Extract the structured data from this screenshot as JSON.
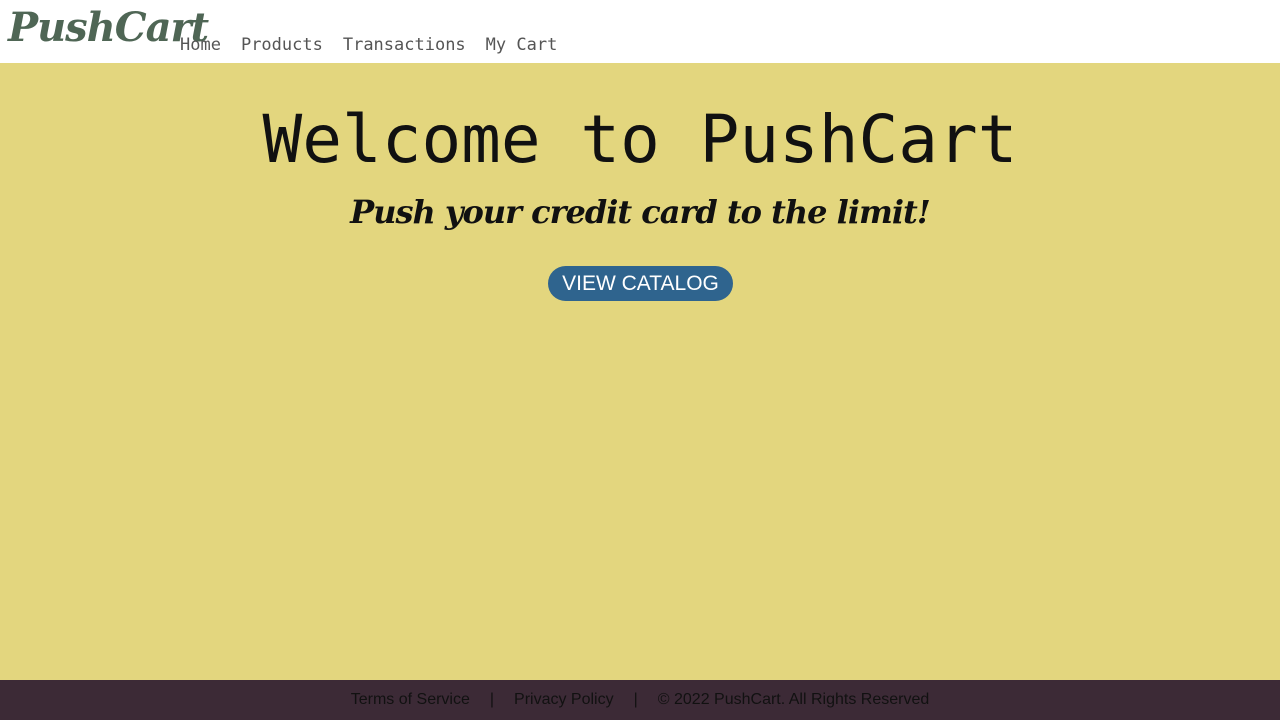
{
  "header": {
    "logo": "PushCart",
    "nav": {
      "home": "Home",
      "products": "Products",
      "transactions": "Transactions",
      "cart": "My Cart"
    }
  },
  "hero": {
    "title": "Welcome to PushCart",
    "tagline": "Push your credit card to the limit!",
    "cta_label": "VIEW CATALOG"
  },
  "footer": {
    "terms": "Terms of Service",
    "separator": "|",
    "privacy": "Privacy Policy",
    "copyright": "© 2022 PushCart. All Rights Reserved"
  },
  "colors": {
    "header_bg": "#ffffff",
    "logo": "#4f6655",
    "main_bg": "#e3d67e",
    "cta_bg": "#2f648e",
    "footer_bg": "#3c2a36"
  }
}
